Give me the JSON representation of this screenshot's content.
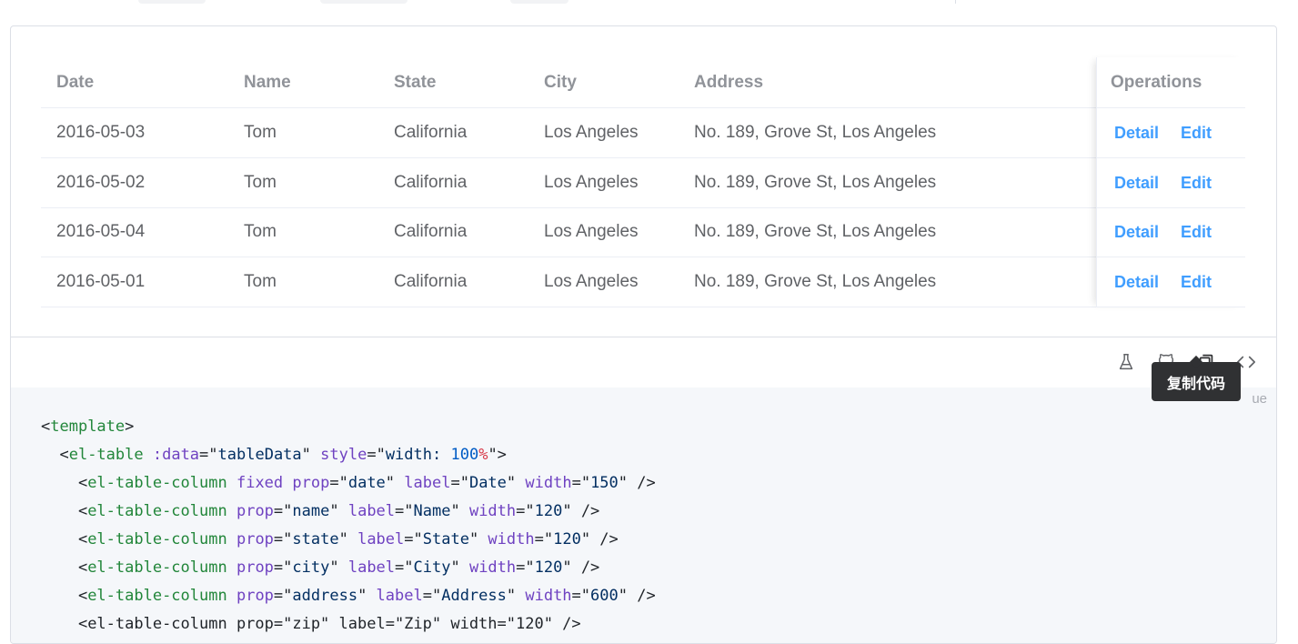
{
  "table": {
    "headers": {
      "date": "Date",
      "name": "Name",
      "state": "State",
      "city": "City",
      "address": "Address",
      "operations": "Operations"
    },
    "rows": [
      {
        "date": "2016-05-03",
        "name": "Tom",
        "state": "California",
        "city": "Los Angeles",
        "address": "No. 189, Grove St, Los Angeles"
      },
      {
        "date": "2016-05-02",
        "name": "Tom",
        "state": "California",
        "city": "Los Angeles",
        "address": "No. 189, Grove St, Los Angeles"
      },
      {
        "date": "2016-05-04",
        "name": "Tom",
        "state": "California",
        "city": "Los Angeles",
        "address": "No. 189, Grove St, Los Angeles"
      },
      {
        "date": "2016-05-01",
        "name": "Tom",
        "state": "California",
        "city": "Los Angeles",
        "address": "No. 189, Grove St, Los Angeles"
      }
    ],
    "ops": {
      "detail": "Detail",
      "edit": "Edit"
    }
  },
  "toolbar": {
    "icons": [
      "flask-icon",
      "github-icon",
      "copy-icon",
      "code-icon"
    ],
    "tooltip": "复制代码",
    "lang_hint": "ue"
  },
  "code": {
    "l1_tag": "template",
    "l2_tag": "el-table",
    "l2_attr1": ":data",
    "l2_val1": "tableData",
    "l2_attr2": "style",
    "l2_val2_prop": "width: ",
    "l2_val2_num": "100",
    "l2_val2_pct": "%",
    "col_tag": "el-table-column",
    "l3_fixed": "fixed",
    "prop_attr": "prop",
    "label_attr": "label",
    "width_attr": "width",
    "l3_prop": "date",
    "l3_label": "Date",
    "l3_width": "150",
    "l4_prop": "name",
    "l4_label": "Name",
    "l4_width": "120",
    "l5_prop": "state",
    "l5_label": "State",
    "l5_width": "120",
    "l6_prop": "city",
    "l6_label": "City",
    "l6_width": "120",
    "l7_prop": "address",
    "l7_label": "Address",
    "l7_width": "600",
    "l8_partial": "<el-table-column prop=\"zip\" label=\"Zip\" width=\"120\" />"
  },
  "colors": {
    "link": "#409eff",
    "tooltip_bg": "#303133",
    "code_bg": "#f5f7fa"
  }
}
